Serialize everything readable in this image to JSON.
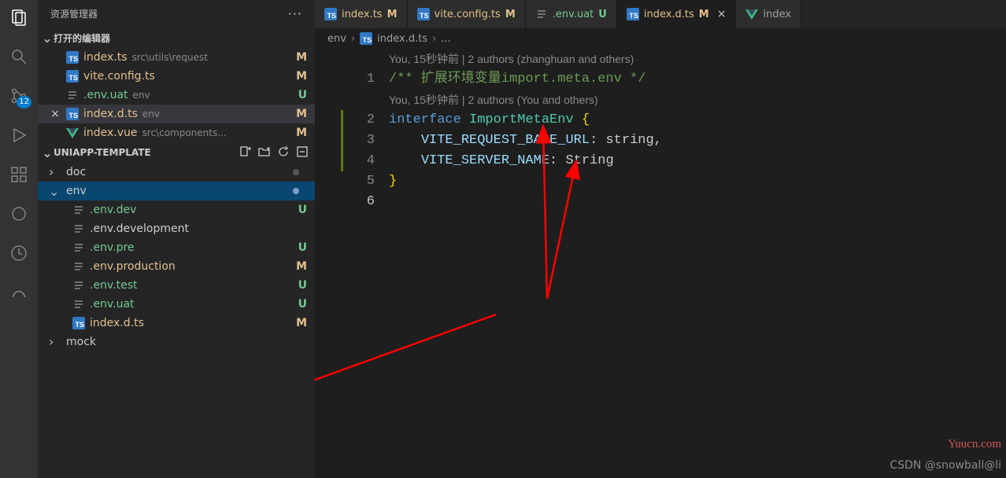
{
  "activity": {
    "badge": "12"
  },
  "sidebar": {
    "title": "资源管理器",
    "openEditorsTitle": "打开的编辑器",
    "projectName": "UNIAPP-TEMPLATE",
    "openEditors": [
      {
        "icon": "ts",
        "name": "index.ts",
        "sub": "src\\utils\\request",
        "status": "M",
        "cls": "modified"
      },
      {
        "icon": "ts",
        "name": "vite.config.ts",
        "sub": "",
        "status": "M",
        "cls": "modified"
      },
      {
        "icon": "env",
        "name": ".env.uat",
        "sub": "env",
        "status": "U",
        "cls": "untracked"
      },
      {
        "icon": "ts",
        "name": "index.d.ts",
        "sub": "env",
        "status": "M",
        "cls": "modified",
        "close": true,
        "selected": true
      },
      {
        "icon": "vue",
        "name": "index.vue",
        "sub": "src\\components...",
        "status": "M",
        "cls": "modified"
      }
    ],
    "tree": [
      {
        "type": "folder",
        "name": "doc",
        "open": false,
        "dot": true
      },
      {
        "type": "folder",
        "name": "env",
        "open": true,
        "selected": true,
        "dot": true
      },
      {
        "type": "file",
        "icon": "env",
        "name": ".env.dev",
        "status": "U",
        "cls": "untracked",
        "indent": 1
      },
      {
        "type": "file",
        "icon": "env",
        "name": ".env.development",
        "status": "",
        "cls": "",
        "indent": 1
      },
      {
        "type": "file",
        "icon": "env",
        "name": ".env.pre",
        "status": "U",
        "cls": "untracked",
        "indent": 1
      },
      {
        "type": "file",
        "icon": "env",
        "name": ".env.production",
        "status": "M",
        "cls": "modified",
        "indent": 1
      },
      {
        "type": "file",
        "icon": "env",
        "name": ".env.test",
        "status": "U",
        "cls": "untracked",
        "indent": 1
      },
      {
        "type": "file",
        "icon": "env",
        "name": ".env.uat",
        "status": "U",
        "cls": "untracked",
        "indent": 1
      },
      {
        "type": "file",
        "icon": "ts",
        "name": "index.d.ts",
        "status": "M",
        "cls": "modified",
        "indent": 1
      },
      {
        "type": "folder",
        "name": "mock",
        "open": false
      }
    ]
  },
  "tabs": [
    {
      "icon": "ts",
      "name": "index.ts",
      "status": "M",
      "cls": "modified"
    },
    {
      "icon": "ts",
      "name": "vite.config.ts",
      "status": "M",
      "cls": "modified"
    },
    {
      "icon": "env",
      "name": ".env.uat",
      "status": "U",
      "cls": "untracked"
    },
    {
      "icon": "ts",
      "name": "index.d.ts",
      "status": "M",
      "cls": "modified",
      "active": true,
      "closeBtn": true
    },
    {
      "icon": "vue",
      "name": "index",
      "status": "",
      "cls": "",
      "truncated": true
    }
  ],
  "breadcrumbs": {
    "seg1": "env",
    "seg2": "index.d.ts",
    "seg3": "..."
  },
  "lens1": "You, 15秒钟前 | 2 authors (zhanghuan and others)",
  "lens2": "You, 15秒钟前 | 2 authors (You and others)",
  "code": {
    "l1_comment": "/** 扩展环境变量import.meta.env */",
    "l2_kw": "interface",
    "l2_type": "ImportMetaEnv",
    "l2_brace": "{",
    "l3_prop": "VITE_REQUEST_BASE_URL",
    "l3_rest": ": string,",
    "l4_prop": "VITE_SERVER_NAME",
    "l4_rest": ": String",
    "l5_brace": "}"
  },
  "watermarkA": "Yuucn.com",
  "watermarkB": "CSDN @snowball@li"
}
